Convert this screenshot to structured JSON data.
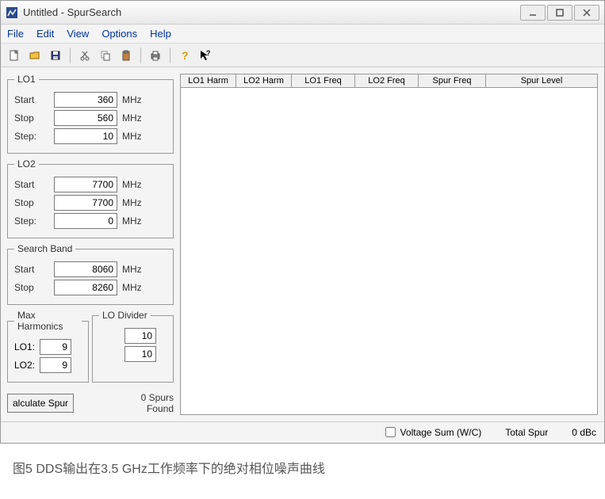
{
  "window": {
    "title": "Untitled - SpurSearch"
  },
  "menu": {
    "file": "File",
    "edit": "Edit",
    "view": "View",
    "options": "Options",
    "help": "Help"
  },
  "lo1": {
    "legend": "LO1",
    "start_label": "Start",
    "start_value": "360",
    "start_unit": "MHz",
    "stop_label": "Stop",
    "stop_value": "560",
    "stop_unit": "MHz",
    "step_label": "Step:",
    "step_value": "10",
    "step_unit": "MHz"
  },
  "lo2": {
    "legend": "LO2",
    "start_label": "Start",
    "start_value": "7700",
    "start_unit": "MHz",
    "stop_label": "Stop",
    "stop_value": "7700",
    "stop_unit": "MHz",
    "step_label": "Step:",
    "step_value": "0",
    "step_unit": "MHz"
  },
  "searchband": {
    "legend": "Search Band",
    "start_label": "Start",
    "start_value": "8060",
    "start_unit": "MHz",
    "stop_label": "Stop",
    "stop_value": "8260",
    "stop_unit": "MHz"
  },
  "maxharm": {
    "legend": "Max Harmonics",
    "lo1_label": "LO1:",
    "lo1_value": "9",
    "lo2_label": "LO2:",
    "lo2_value": "9"
  },
  "lodiv": {
    "legend": "LO Divider",
    "v1": "10",
    "v2": "10"
  },
  "calc": {
    "button": "alculate Spur",
    "found_count": "0 Spurs",
    "found_label": "Found"
  },
  "table": {
    "cols": [
      "LO1 Harm",
      "LO2 Harm",
      "LO1 Freq",
      "LO2 Freq",
      "Spur Freq",
      "Spur Level"
    ]
  },
  "status": {
    "voltage_sum": "Voltage Sum (W/C)",
    "total_spur_label": "Total Spur",
    "total_spur_value": "0",
    "total_spur_unit": "dBc"
  },
  "caption": "图5 DDS输出在3.5 GHz工作频率下的绝对相位噪声曲线"
}
